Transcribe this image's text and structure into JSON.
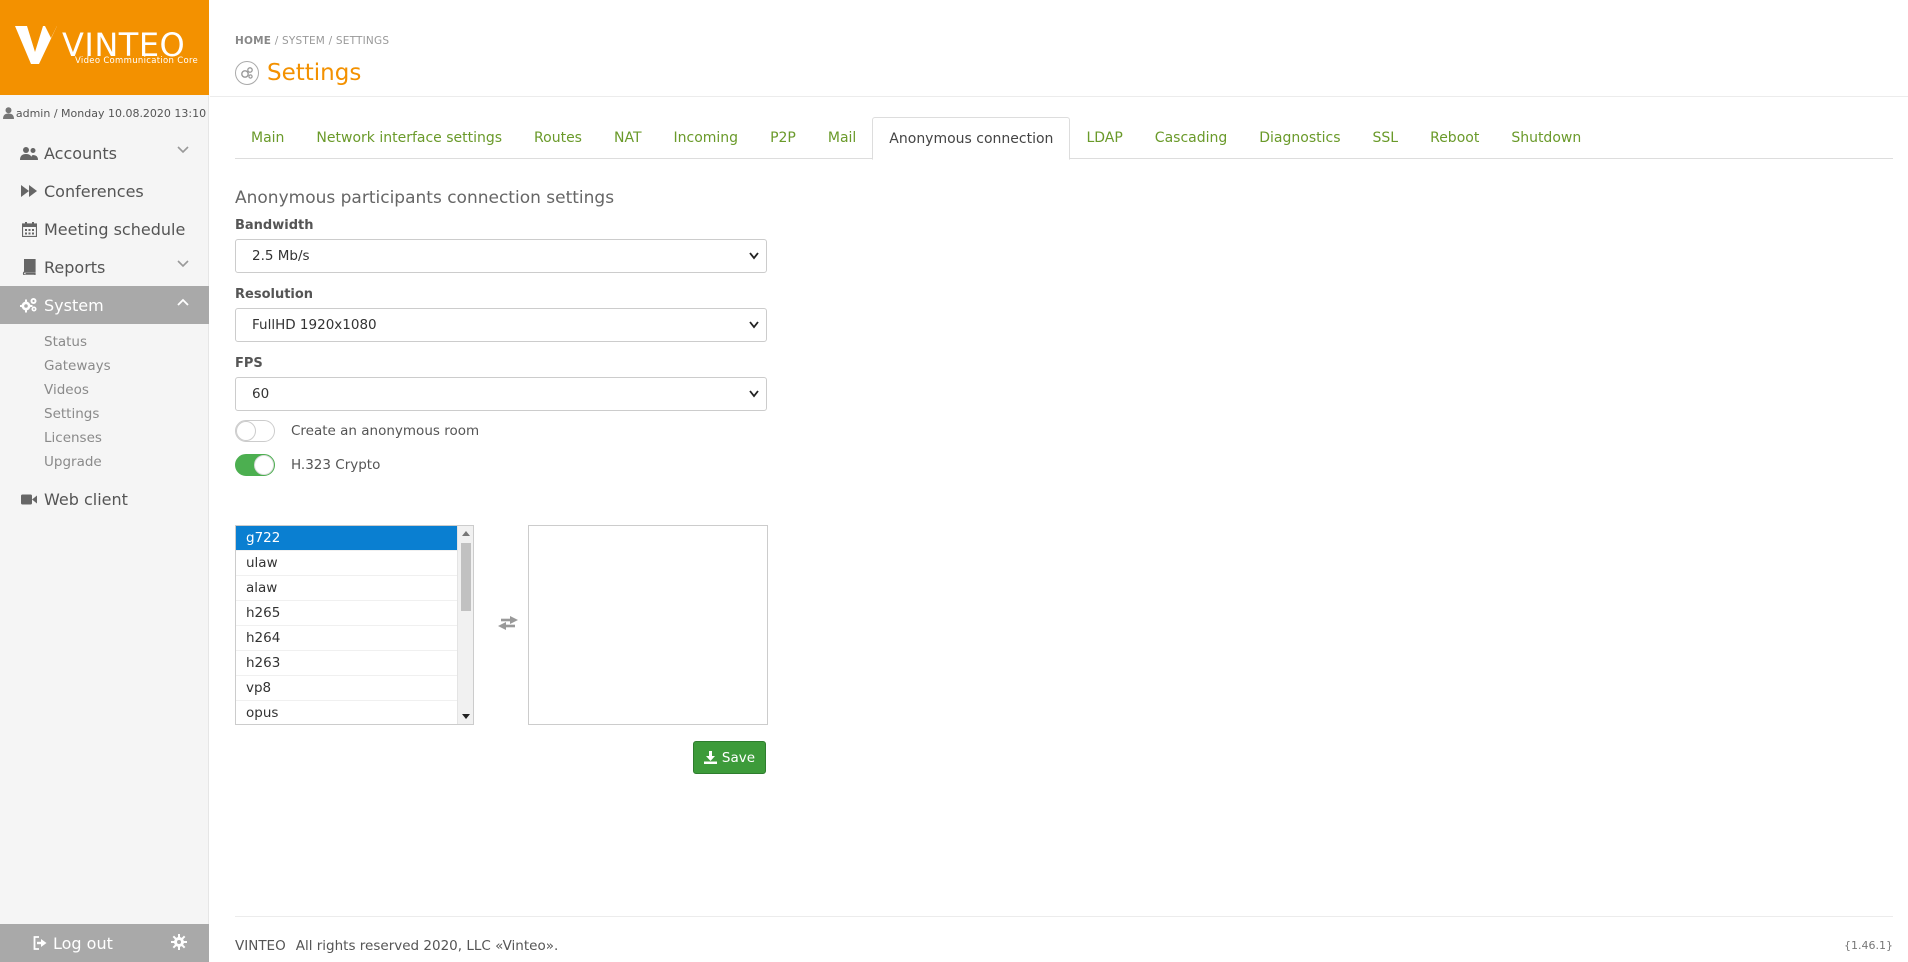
{
  "brand": {
    "logo_text": "VINTEO",
    "logo_subtitle": "Video Communication Core",
    "color": "#f39100"
  },
  "user": {
    "line": "admin / Monday 10.08.2020 13:10"
  },
  "sidebar": {
    "items": [
      {
        "label": "Accounts",
        "icon": "users-icon",
        "has_chevron": true
      },
      {
        "label": "Conferences",
        "icon": "fast-forward-icon",
        "has_chevron": false
      },
      {
        "label": "Meeting schedule",
        "icon": "calendar-icon",
        "has_chevron": false
      },
      {
        "label": "Reports",
        "icon": "book-icon",
        "has_chevron": true
      },
      {
        "label": "System",
        "icon": "gears-icon",
        "has_chevron": true,
        "active": true
      },
      {
        "label": "Web client",
        "icon": "video-camera-icon",
        "has_chevron": false
      }
    ],
    "system_subitems": [
      "Status",
      "Gateways",
      "Videos",
      "Settings",
      "Licenses",
      "Upgrade"
    ],
    "logout_label": "Log out"
  },
  "header": {
    "breadcrumb": {
      "home": "HOME",
      "sep": "/",
      "system": "SYSTEM",
      "settings": "SETTINGS"
    },
    "title": "Settings"
  },
  "tabs": [
    {
      "label": "Main"
    },
    {
      "label": "Network interface settings"
    },
    {
      "label": "Routes"
    },
    {
      "label": "NAT"
    },
    {
      "label": "Incoming"
    },
    {
      "label": "P2P"
    },
    {
      "label": "Mail"
    },
    {
      "label": "Anonymous connection",
      "active": true
    },
    {
      "label": "LDAP"
    },
    {
      "label": "Cascading"
    },
    {
      "label": "Diagnostics"
    },
    {
      "label": "SSL"
    },
    {
      "label": "Reboot"
    },
    {
      "label": "Shutdown"
    }
  ],
  "form": {
    "section_title": "Anonymous participants connection settings",
    "bandwidth_label": "Bandwidth",
    "bandwidth_value": "2.5 Mb/s",
    "resolution_label": "Resolution",
    "resolution_value": "FullHD 1920x1080",
    "fps_label": "FPS",
    "fps_value": "60",
    "anon_room_label": "Create an anonymous room",
    "anon_room_on": false,
    "h323_label": "H.323 Crypto",
    "h323_on": true,
    "codecs_available": [
      "g722",
      "ulaw",
      "alaw",
      "h265",
      "h264",
      "h263",
      "vp8",
      "opus"
    ],
    "codecs_selected_index": 0,
    "save_label": "Save"
  },
  "footer": {
    "brand": "VINTEO",
    "copyright": "All rights reserved 2020, LLC «Vinteo».",
    "version": "{1.46.1}"
  },
  "colors": {
    "accent": "#f39100",
    "tab_link": "#6a9a2a",
    "save_green": "#3d9b3a",
    "selection_blue": "#0a7fd1",
    "sidebar_active": "#a9a9a9"
  }
}
